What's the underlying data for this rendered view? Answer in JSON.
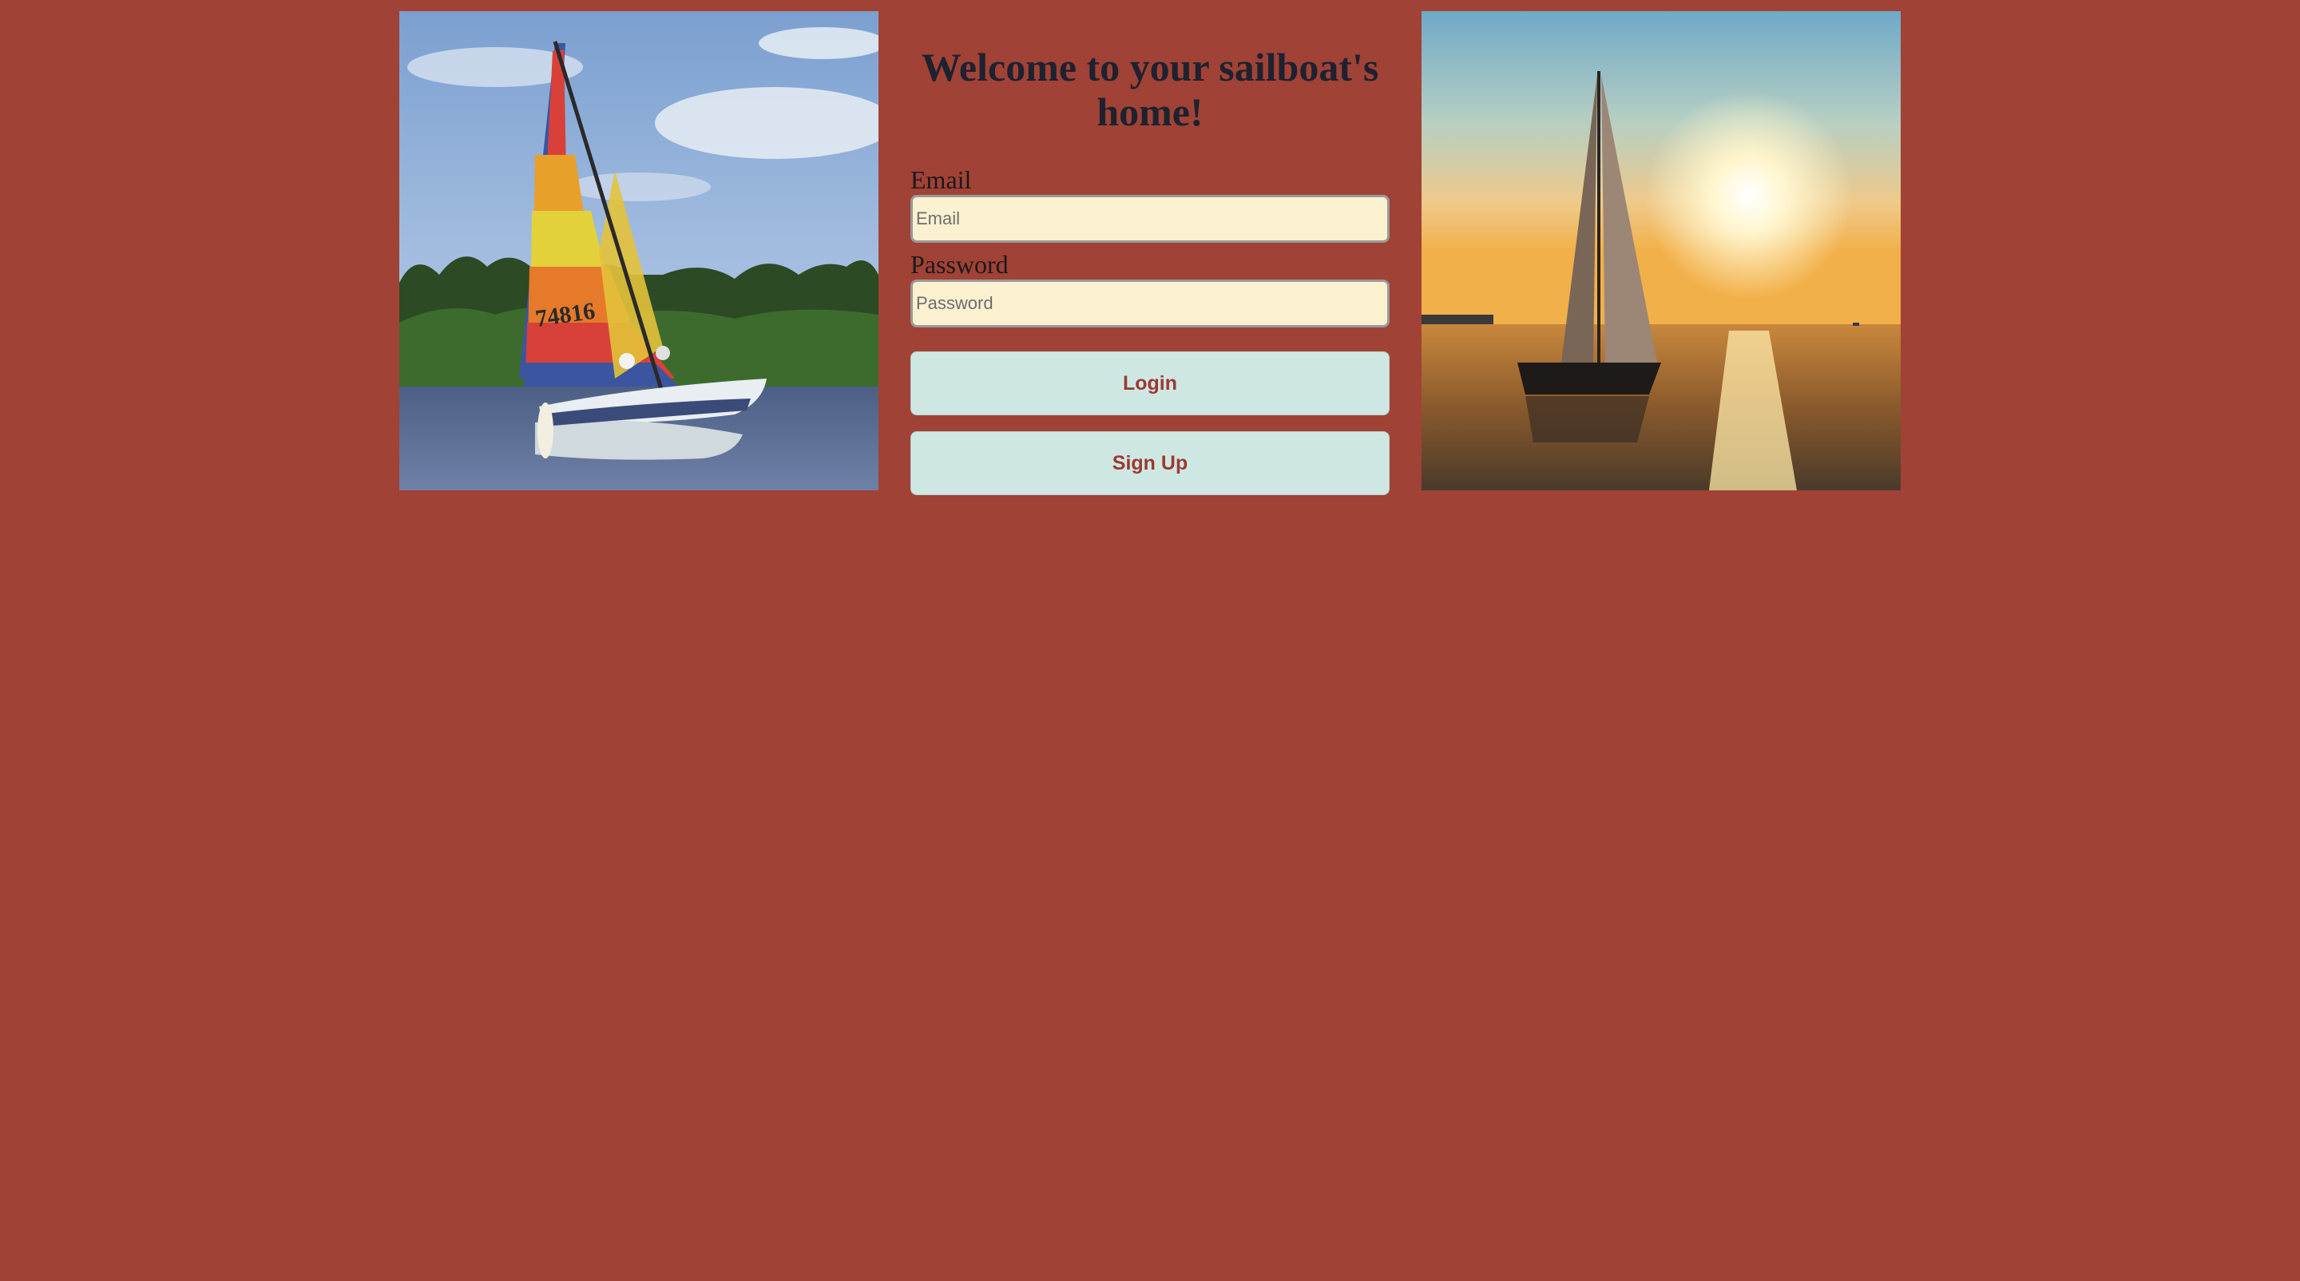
{
  "page": {
    "title": "Welcome to your sailboat's home!",
    "background": "#a04236"
  },
  "images": {
    "left_alt": "Catamaran with rainbow sail",
    "right_alt": "Sailboat at sunset",
    "sail_number": "74816"
  },
  "form": {
    "email_label": "Email",
    "email_placeholder": "Email",
    "email_value": "",
    "password_label": "Password",
    "password_placeholder": "Password",
    "password_value": "",
    "login_label": "Login",
    "signup_label": "Sign Up"
  },
  "colors": {
    "input_bg": "#fbf1d0",
    "button_bg": "#cfe7e3",
    "button_text": "#9b3a30",
    "title_text": "#1e2230"
  }
}
